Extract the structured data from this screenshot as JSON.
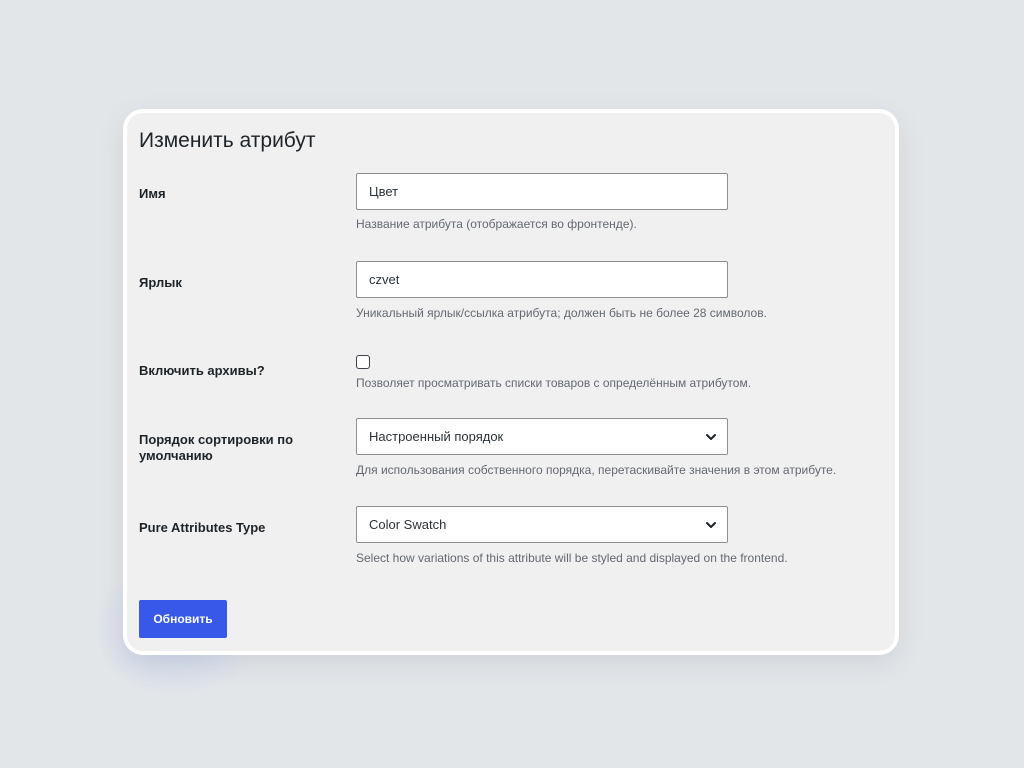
{
  "page": {
    "title": "Изменить атрибут"
  },
  "fields": {
    "name": {
      "label": "Имя",
      "value": "Цвет",
      "description": "Название атрибута (отображается во фронтенде)."
    },
    "slug": {
      "label": "Ярлык",
      "value": "czvet",
      "description": "Уникальный ярлык/ссылка атрибута; должен быть не более 28 символов."
    },
    "archives": {
      "label": "Включить архивы?",
      "checked": false,
      "description": "Позволяет просматривать списки товаров с определённым атрибутом."
    },
    "sort_order": {
      "label": "Порядок сортировки по умолчанию",
      "value": "Настроенный порядок",
      "description": "Для использования собственного порядка, перетаскивайте значения в этом атрибуте."
    },
    "pure_type": {
      "label": "Pure Attributes Type",
      "value": "Color Swatch",
      "description": "Select how variations of this attribute will be styled and displayed on the frontend."
    }
  },
  "actions": {
    "update_label": "Обновить"
  },
  "icons": {
    "select_arrow": "chevron-down-icon"
  },
  "colors": {
    "primary": "#3858e9",
    "background": "#e3e6e9",
    "card": "#f0f0f1"
  }
}
